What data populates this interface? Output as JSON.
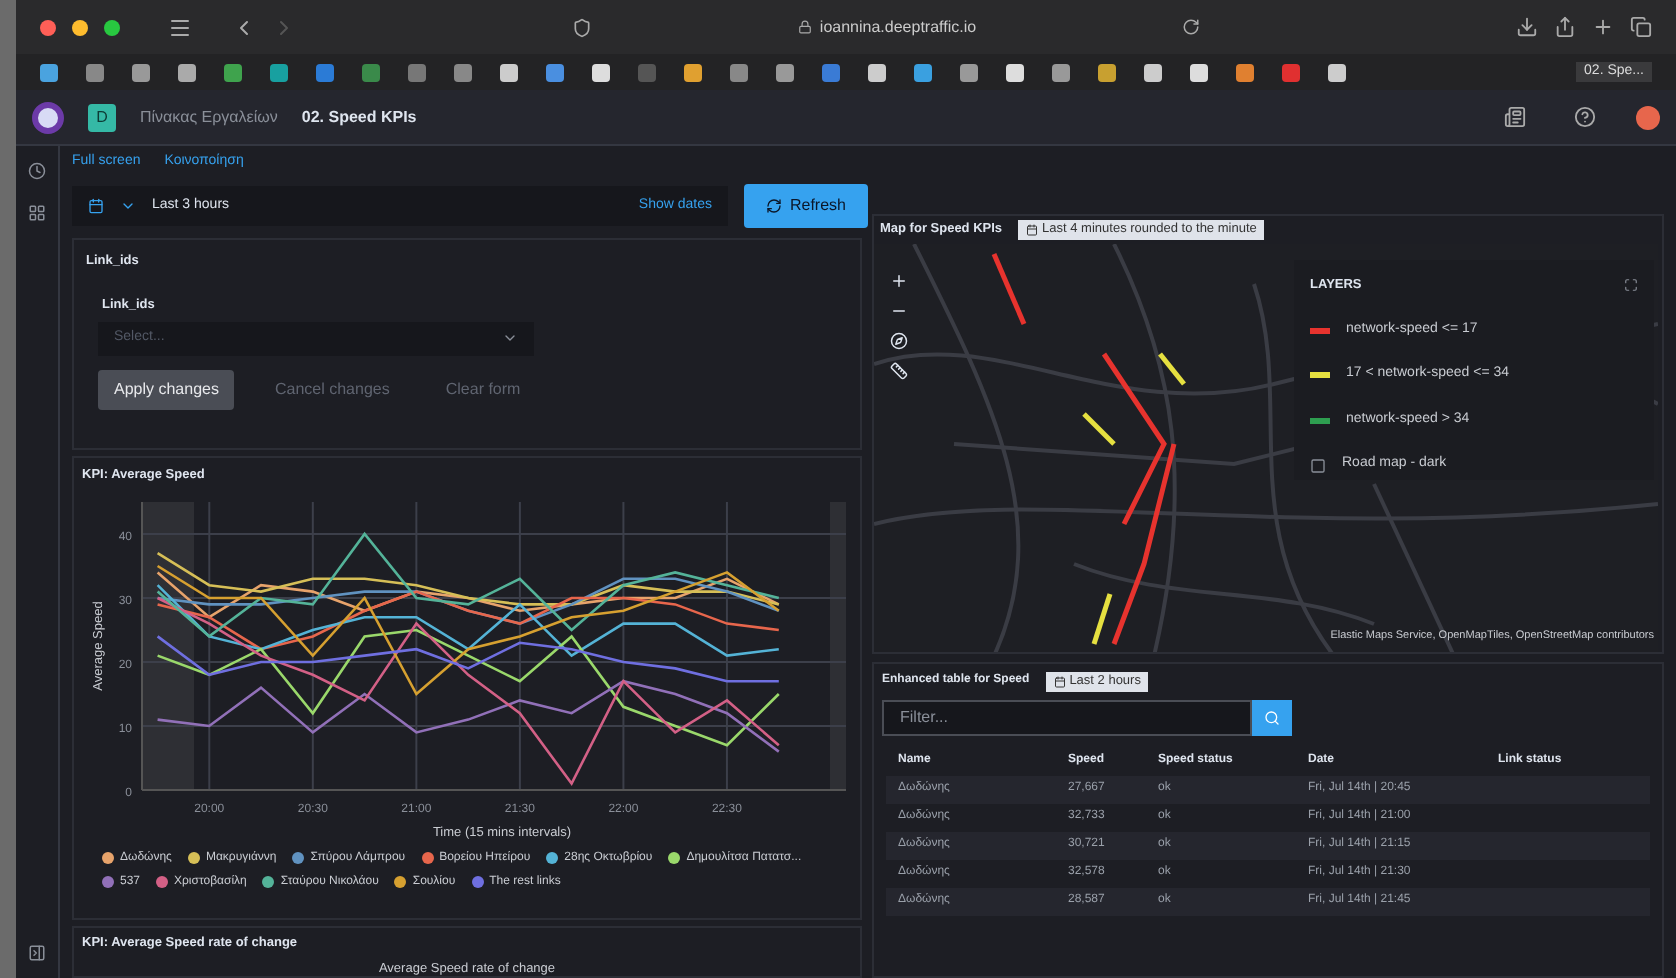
{
  "browser": {
    "url": "ioannina.deeptraffic.io",
    "tab_title": "02. Spe..."
  },
  "header": {
    "space_badge": "D",
    "breadcrumbs": [
      "Πίνακας Εργαλείων",
      "02. Speed KPIs"
    ]
  },
  "top_links": [
    "Full screen",
    "Κοινοποίηση"
  ],
  "time_bar": {
    "range": "Last 3 hours",
    "show_dates": "Show dates",
    "refresh": "Refresh"
  },
  "controls_panel": {
    "title": "Link_ids",
    "field_label": "Link_ids",
    "placeholder": "Select...",
    "buttons": [
      {
        "label": "Apply changes",
        "disabled": false
      },
      {
        "label": "Cancel changes",
        "disabled": true
      },
      {
        "label": "Clear form",
        "disabled": true
      }
    ]
  },
  "speed_panel": {
    "title": "KPI: Average Speed",
    "chart_data": {
      "type": "line",
      "xlabel": "Time (15 mins intervals)",
      "ylabel": "Average Speed",
      "categories": [
        null,
        "20:00",
        null,
        "20:30",
        null,
        "21:00",
        null,
        "21:30",
        null,
        "22:00",
        null,
        "22:30",
        null
      ],
      "grid": true,
      "ylim": [
        0,
        45
      ],
      "yticks": [
        0,
        10,
        20,
        30,
        40
      ],
      "series": [
        {
          "name": "Δωδώνης",
          "color": "#e7a36b",
          "values": [
            34,
            27,
            32,
            31,
            28,
            31,
            30,
            28,
            29,
            30,
            30,
            33,
            29
          ]
        },
        {
          "name": "Μακρυγιάννη",
          "color": "#d6bf57",
          "values": [
            37,
            32,
            31,
            33,
            33,
            32,
            30,
            29,
            29,
            32,
            31,
            31,
            29
          ]
        },
        {
          "name": "Σπύρου Λάμπρου",
          "color": "#6092c0",
          "values": [
            30,
            29,
            29,
            30,
            31,
            31,
            28,
            26,
            29,
            33,
            33,
            31,
            28
          ]
        },
        {
          "name": "Βορείου Ηπείρου",
          "color": "#e7664c",
          "values": [
            29,
            27,
            22,
            24,
            28,
            31,
            28,
            26,
            30,
            30,
            29,
            26,
            25
          ]
        },
        {
          "name": "28ης Οκτωβρίου",
          "color": "#54b3d6",
          "values": [
            32,
            24,
            22,
            25,
            27,
            27,
            22,
            29,
            21,
            26,
            26,
            21,
            22
          ]
        },
        {
          "name": "Δημουλίτσα Πατατσ...",
          "color": "#9ad86b",
          "values": [
            21,
            18,
            22,
            12,
            24,
            25,
            21,
            17,
            24,
            13,
            10,
            7,
            15
          ]
        },
        {
          "name": "537",
          "color": "#9170b8",
          "values": [
            11,
            10,
            16,
            9,
            15,
            9,
            11,
            14,
            12,
            17,
            15,
            12,
            6
          ]
        },
        {
          "name": "Χριστοβασίλη",
          "color": "#d36086",
          "values": [
            30,
            26,
            21,
            18,
            14,
            26,
            18,
            12,
            1,
            17,
            9,
            14,
            7
          ]
        },
        {
          "name": "Σταύρου Νικολάου",
          "color": "#54b399",
          "values": [
            31,
            24,
            30,
            29,
            40,
            30,
            29,
            33,
            25,
            32,
            34,
            32,
            30
          ]
        },
        {
          "name": "Σουλίου",
          "color": "#d6a030",
          "values": [
            35,
            30,
            30,
            21,
            30,
            15,
            22,
            24,
            27,
            28,
            31,
            34,
            28
          ]
        },
        {
          "name": "The rest links",
          "color": "#6f6fe0",
          "values": [
            24,
            18,
            20,
            20,
            21,
            22,
            19,
            23,
            22,
            20,
            19,
            17,
            17
          ]
        }
      ]
    }
  },
  "rate_panel": {
    "title": "KPI: Average Speed rate of change",
    "chart_title": "Average Speed rate of change"
  },
  "map_panel": {
    "title": "Map for Speed KPIs",
    "time_badge": "Last 4 minutes rounded to the minute",
    "layers_title": "LAYERS",
    "layers": [
      {
        "kind": "line",
        "label": "network-speed <= 17",
        "color": "#e7332e"
      },
      {
        "kind": "line",
        "label": "17 < network-speed <= 34",
        "color": "#e6e040"
      },
      {
        "kind": "line",
        "label": "network-speed > 34",
        "color": "#2e9e50"
      },
      {
        "kind": "tiles",
        "label": "Road map - dark"
      }
    ],
    "attribution": "Elastic Maps Service, OpenMapTiles, OpenStreetMap contributors"
  },
  "table_panel": {
    "title": "Enhanced table for Speed",
    "time_badge": "Last 2 hours",
    "filter_placeholder": "Filter...",
    "columns": [
      "Name",
      "Speed",
      "Speed status",
      "Date",
      "Link status"
    ],
    "rows": [
      [
        "Δωδώνης",
        "27,667",
        "ok",
        "Fri, Jul 14th | 20:45"
      ],
      [
        "Δωδώνης",
        "32,733",
        "ok",
        "Fri, Jul 14th | 21:00"
      ],
      [
        "Δωδώνης",
        "30,721",
        "ok",
        "Fri, Jul 14th | 21:15"
      ],
      [
        "Δωδώνης",
        "32,578",
        "ok",
        "Fri, Jul 14th | 21:30"
      ],
      [
        "Δωδώνης",
        "28,587",
        "ok",
        "Fri, Jul 14th | 21:45"
      ]
    ]
  }
}
